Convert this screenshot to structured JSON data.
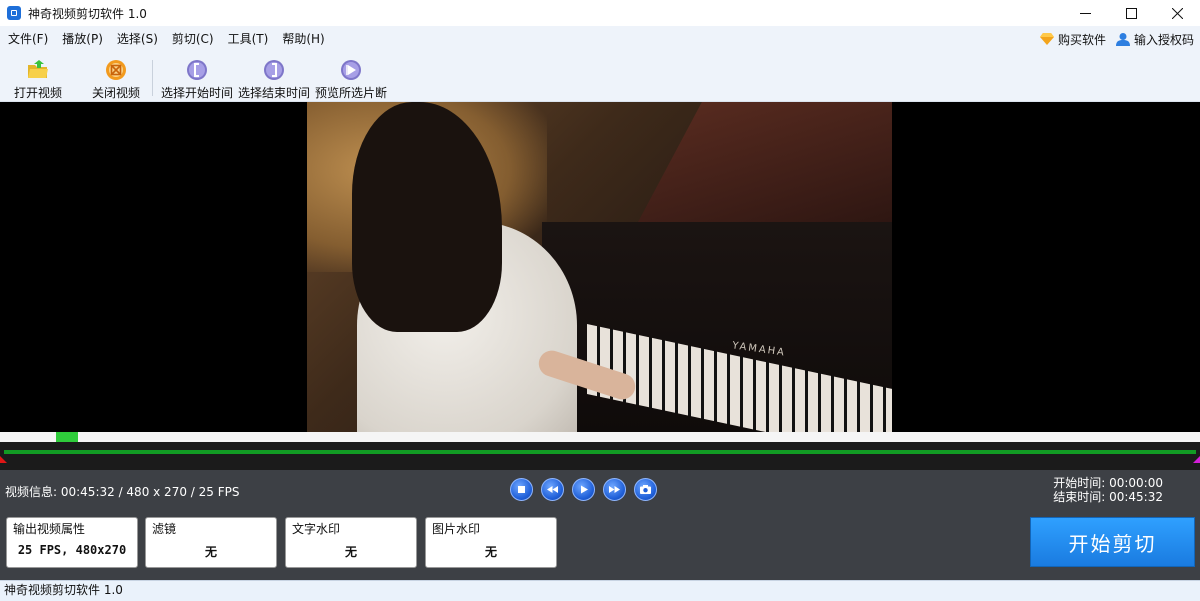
{
  "window": {
    "title": "神奇视频剪切软件 1.0",
    "icon": "app-icon"
  },
  "menu": {
    "items": [
      {
        "label": "文件(F)"
      },
      {
        "label": "播放(P)"
      },
      {
        "label": "选择(S)"
      },
      {
        "label": "剪切(C)"
      },
      {
        "label": "工具(T)"
      },
      {
        "label": "帮助(H)"
      }
    ],
    "buy_label": "购买软件",
    "license_label": "输入授权码"
  },
  "toolbar": {
    "open_label": "打开视频",
    "close_label": "关闭视频",
    "select_start_label": "选择开始时间",
    "select_end_label": "选择结束时间",
    "preview_label": "预览所选片断"
  },
  "video": {
    "brand_text": "YAMAHA"
  },
  "info": {
    "video_info": "视频信息: 00:45:32 / 480 x 270 / 25 FPS",
    "start_time": "开始时间: 00:00:00",
    "end_time": "结束时间: 00:45:32"
  },
  "properties": {
    "output_title": "输出视频属性",
    "output_value": "25 FPS, 480x270",
    "filter_title": "滤镜",
    "filter_value": "无",
    "text_wm_title": "文字水印",
    "text_wm_value": "无",
    "image_wm_title": "图片水印",
    "image_wm_value": "无"
  },
  "actions": {
    "start_cut_label": "开始剪切"
  },
  "status": {
    "text": "神奇视频剪切软件 1.0"
  },
  "colors": {
    "accent": "#1a7be0",
    "timeline_green": "#2fcc3b",
    "panel_bg": "#3d4045"
  }
}
